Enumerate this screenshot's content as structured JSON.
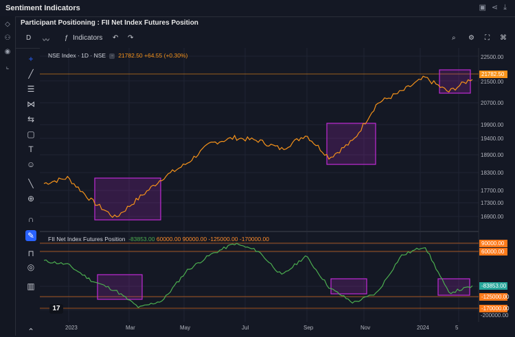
{
  "window": {
    "title": "Sentiment Indicators"
  },
  "subtitle": "Participant Positioning : FII Net Index Futures Position",
  "toolbar": {
    "interval": "D",
    "indicators_label": "Indicators"
  },
  "main_legend": {
    "symbol": "NSE Index · 1D · NSE",
    "price": "21782.50",
    "change": "+64.55 (+0.30%)"
  },
  "sub_legend": {
    "name": "FII Net Index Futures Position",
    "values": [
      "-83853.00",
      "60000.00",
      "90000.00",
      "-125000.00",
      "-170000.00"
    ]
  },
  "price_axis": [
    "22500.00",
    "21500.00",
    "20700.00",
    "19900.00",
    "19400.00",
    "18900.00",
    "18300.00",
    "17700.00",
    "17300.00",
    "16900.00"
  ],
  "price_tag": "21782.50",
  "sub_axis": [
    "90000.00",
    "60000.00",
    "-83853.00",
    "-125000.00",
    "-170000.00",
    "-200000.00"
  ],
  "x_axis": [
    "2023",
    "Mar",
    "May",
    "Jul",
    "Sep",
    "Nov",
    "2024",
    "5"
  ],
  "colors": {
    "price_line": "#f7931a",
    "fii_line": "#4caf50",
    "highlight": "#c02bd6",
    "level_line": "#ff7a1a"
  },
  "chart_data": [
    {
      "type": "line",
      "x": [
        "2023",
        "Mar",
        "May",
        "Jul",
        "Sep",
        "Nov",
        "2024"
      ],
      "series": [
        {
          "values": [
            18100,
            18300,
            17500,
            16900,
            17600,
            18300,
            18800,
            19500,
            19700,
            19600,
            19300,
            19800,
            19000,
            19600,
            20900,
            21300,
            21800,
            21300,
            21782.5
          ]
        }
      ],
      "ylim": [
        16900,
        22500
      ]
    },
    {
      "type": "line",
      "x": [
        "2023",
        "Mar",
        "May",
        "Jul",
        "Sep",
        "Nov",
        "2024"
      ],
      "series": [
        {
          "values": [
            20000,
            5000,
            -60000,
            -100000,
            -170000,
            -140000,
            -20000,
            45000,
            90000,
            60000,
            -40000,
            40000,
            -90000,
            -150000,
            -110000,
            40000,
            80000,
            -110000,
            -83853
          ]
        }
      ],
      "ylim": [
        -200000,
        100000
      ]
    }
  ]
}
